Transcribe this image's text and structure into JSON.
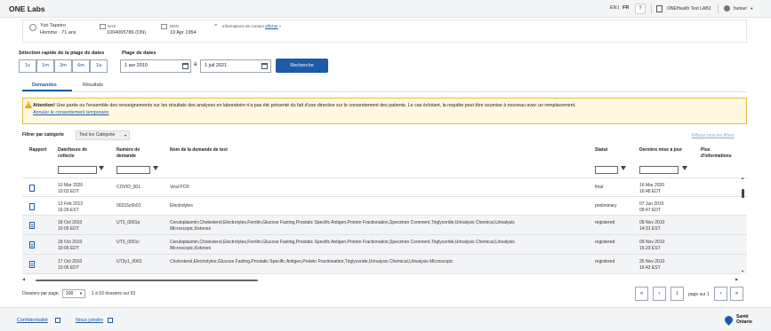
{
  "header": {
    "app_title": "ONE Labs",
    "lang_en": "EN",
    "lang_sep": "|",
    "lang_fr": "FR",
    "help_label": "?",
    "org_label": "ONEHealth Test LAB2",
    "user_label": "fsetser"
  },
  "patient": {
    "name": "Yuri Tapeiro",
    "sex_age": "Homme · 71 ans",
    "nas_label": "NAS",
    "nas_value": "1004065786 (ON)",
    "dob_label": "DDN",
    "dob_value": "19 Apr 1954",
    "contact_label": "Informations de contact",
    "contact_link": "afficher"
  },
  "date_filter": {
    "quick_label": "Sélection rapide de la plage de dates",
    "range_label": "Plage de dates",
    "quick_buttons": [
      "1s",
      "1m",
      "3m",
      "6m",
      "1a"
    ],
    "from_date": "1 avr 2010",
    "to_sep": "à",
    "to_date": "1 juil 2021",
    "search_label": "Recherche"
  },
  "tabs": [
    {
      "label": "Demandes",
      "active": true
    },
    {
      "label": "Résultats",
      "active": false
    }
  ],
  "warning": {
    "bold": "Attention!",
    "text": " Une partie ou l'ensemble des renseignements sur les résultats des analyses en laboratoire n'a pas été présenté du fait d'une directive sur le consentement des patients. Le cas échéant, la requête peut être soumise à nouveau avec un remplacement.",
    "link": "Annuler le consentement temporaire"
  },
  "filter": {
    "label": "Filtrer par catégorie",
    "value": "Tout les Catégorie",
    "clear_label": "Effacer tous les filtres"
  },
  "table": {
    "headers": {
      "report": "Rapport",
      "date": "Date/heure de collecte",
      "number": "Numéro de demande",
      "name": "Nom de la demande de test",
      "status": "Statut",
      "updated": "Dernière mise à jour",
      "more": "Plus d'informations"
    },
    "rows": [
      {
        "date": "10 Mar 2020",
        "time": "10:03 EDT",
        "number": "COVID_001",
        "name": "Viral PCR",
        "name2": "",
        "status": "final",
        "upd_date": "16 Mar 2020",
        "upd_time": "16:48 EDT"
      },
      {
        "date": "13 Feb 2013",
        "time": "16:29 EST",
        "number": "00215c6h01",
        "name": "Electrolytes",
        "name2": "",
        "status": "preliminary",
        "upd_date": "07 Jun 2015",
        "upd_time": "09:47 EDT"
      },
      {
        "date": "18 Oct 2010",
        "time": "10:05 EDT",
        "number": "UT3_0001a",
        "name": "Ceruloplasmin,Cholesterol,Electrolytes,Ferritin,Glucose Fasting,Prostatic Specific Antigen,Protein Fractionation,Specimen Comment,Triglyceride,Urinalysis Chemical,Urinalysis",
        "name2": "Microscopic,Ketones",
        "status": "registered",
        "upd_date": "09 Nov 2010",
        "upd_time": "14:31 EST"
      },
      {
        "date": "18 Oct 2010",
        "time": "10:05 EDT",
        "number": "UT3_0001c",
        "name": "Ceruloplasmin,Cholesterol,Electrolytes,Ferritin,Glucose Fasting,Prostatic Specific Antigen,Protein Fractionation,Specimen Comment,Triglyceride,Urinalysis Chemical,Urinalysis",
        "name2": "Microscopic,Ketones",
        "status": "registered",
        "upd_date": "09 Nov 2010",
        "upd_time": "15:23 EST"
      },
      {
        "date": "17 Oct 2010",
        "time": "10:05 EDT",
        "number": "UT3y1_0001",
        "name": "Cholesterol,Electrolytes,Glucose Fasting,Prostatic Specific Antigen,Protein Fractionation,Triglyceride,Urinalysis Chemical,Urinalysis Microscopic",
        "name2": "",
        "status": "registered",
        "upd_date": "25 Nov 2010",
        "upd_time": "16:43 EST"
      }
    ]
  },
  "pagination": {
    "per_page_label": "Dossiers par page:",
    "per_page_value": "100",
    "range_label": "1 à 53 dossiers sur 53",
    "first_icon": "first-page-icon",
    "prev_icon": "prev-page-icon",
    "page_value": "1",
    "page_of": "page sur 1",
    "next_icon": "next-page-icon",
    "last_icon": "last-page-icon"
  },
  "footer": {
    "privacy": "Confidentialité",
    "contact": "Nous joindre",
    "brand_line1": "Santé",
    "brand_line2": "Ontario"
  },
  "colors": {
    "primary": "#1d5aa8",
    "warning_border": "#f2b83a",
    "warning_bg": "#fff7e0"
  }
}
